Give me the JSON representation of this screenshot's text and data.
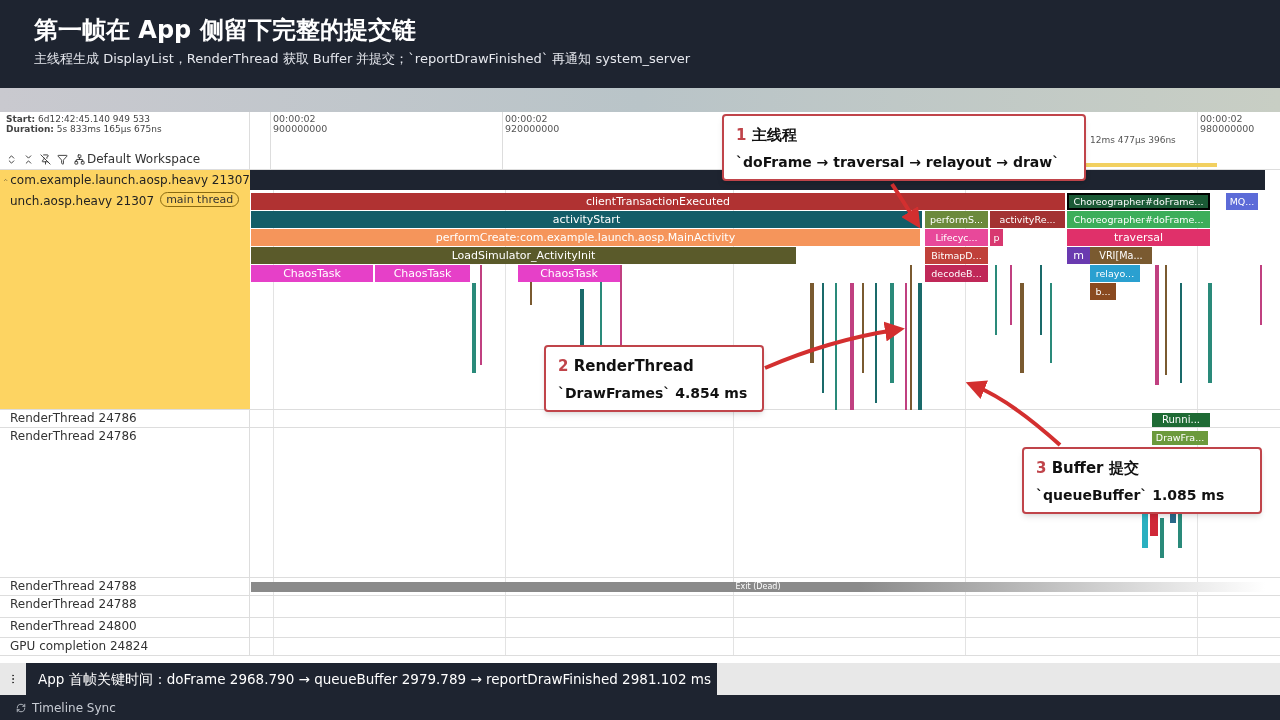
{
  "header": {
    "title": "第一帧在 App 侧留下完整的提交链",
    "subtitle": "主线程生成 DisplayList，RenderThread 获取 Buffer 并提交；`reportDrawFinished` 再通知 system_server"
  },
  "timeline": {
    "start_label": "Start:",
    "start": "6d12:42:45.140 949 533",
    "duration_label": "Duration:",
    "duration": "5s 833ms 165μs 675ns",
    "workspace": "Default Workspace",
    "ticks": [
      {
        "time": "00:00:02",
        "value": "900000000"
      },
      {
        "time": "00:00:02",
        "value": "920000000"
      },
      {
        "time": "00:00:02",
        "value": "980000000"
      }
    ],
    "measure": "12ms 477μs 396ns"
  },
  "process": {
    "title": "com.example.launch.aosp.heavy 21307",
    "expanded": true
  },
  "main_thread": {
    "name": "unch.aosp.heavy 21307",
    "tag": "main thread",
    "slices": [
      {
        "label": "clientTransactionExecuted",
        "color": "#b03232"
      },
      {
        "label": "Choreographer#doFrame...",
        "color": "#1b5a36"
      },
      {
        "label": "MQ...",
        "color": "#5c6bd8"
      },
      {
        "label": "activityStart",
        "color": "#135d68"
      },
      {
        "label": "performS...",
        "color": "#6c8a3c"
      },
      {
        "label": "activityRe...",
        "color": "#a33232"
      },
      {
        "label": "Choreographer#doFrame...",
        "color": "#3cae5a"
      },
      {
        "label": "performCreate:com.example.launch.aosp.MainActivity",
        "color": "#f5955b"
      },
      {
        "label": "Lifecyc...",
        "color": "#e8489a"
      },
      {
        "label": "p",
        "color": "#d83870"
      },
      {
        "label": "traversal",
        "color": "#e0306a"
      },
      {
        "label": "LoadSimulator_ActivityInit",
        "color": "#5a5a2a"
      },
      {
        "label": "BitmapD...",
        "color": "#c0403a"
      },
      {
        "label": "m",
        "color": "#6a3ab0"
      },
      {
        "label": "VRI[Ma...",
        "color": "#7a5a30"
      },
      {
        "label": "ChaosTask",
        "color": "#e640c8"
      },
      {
        "label": "ChaosTask",
        "color": "#e640c8"
      },
      {
        "label": "ChaosTask",
        "color": "#e640c8"
      },
      {
        "label": "decodeB...",
        "color": "#c02858"
      },
      {
        "label": "relayo...",
        "color": "#2aa0d0"
      },
      {
        "label": "b...",
        "color": "#8a4a20"
      }
    ]
  },
  "tracks": [
    {
      "name": "RenderThread 24786",
      "slices": [
        {
          "label": "Runni...",
          "color": "#1e6a34"
        }
      ]
    },
    {
      "name": "RenderThread 24786",
      "slices": [
        {
          "label": "DrawFra...",
          "color": "#6c9a3c"
        }
      ]
    },
    {
      "name": "RenderThread 24788",
      "slices": [
        {
          "label": "Exit (Dead)",
          "color": "#8a8a8a"
        }
      ]
    },
    {
      "name": "RenderThread 24788"
    },
    {
      "name": "RenderThread 24800"
    },
    {
      "name": "GPU completion 24824"
    }
  ],
  "callouts": [
    {
      "number": "1",
      "title": "主线程",
      "detail": "`doFrame → traversal → relayout → draw`"
    },
    {
      "number": "2",
      "title": "RenderThread",
      "detail": "`DrawFrames` 4.854 ms"
    },
    {
      "number": "3",
      "title": "Buffer 提交",
      "detail": "`queueBuffer` 1.085 ms"
    }
  ],
  "status": "App 首帧关键时间：doFrame 2968.790 → queueBuffer 2979.789 → reportDrawFinished 2981.102 ms",
  "bottom_tab": "Timeline Sync"
}
